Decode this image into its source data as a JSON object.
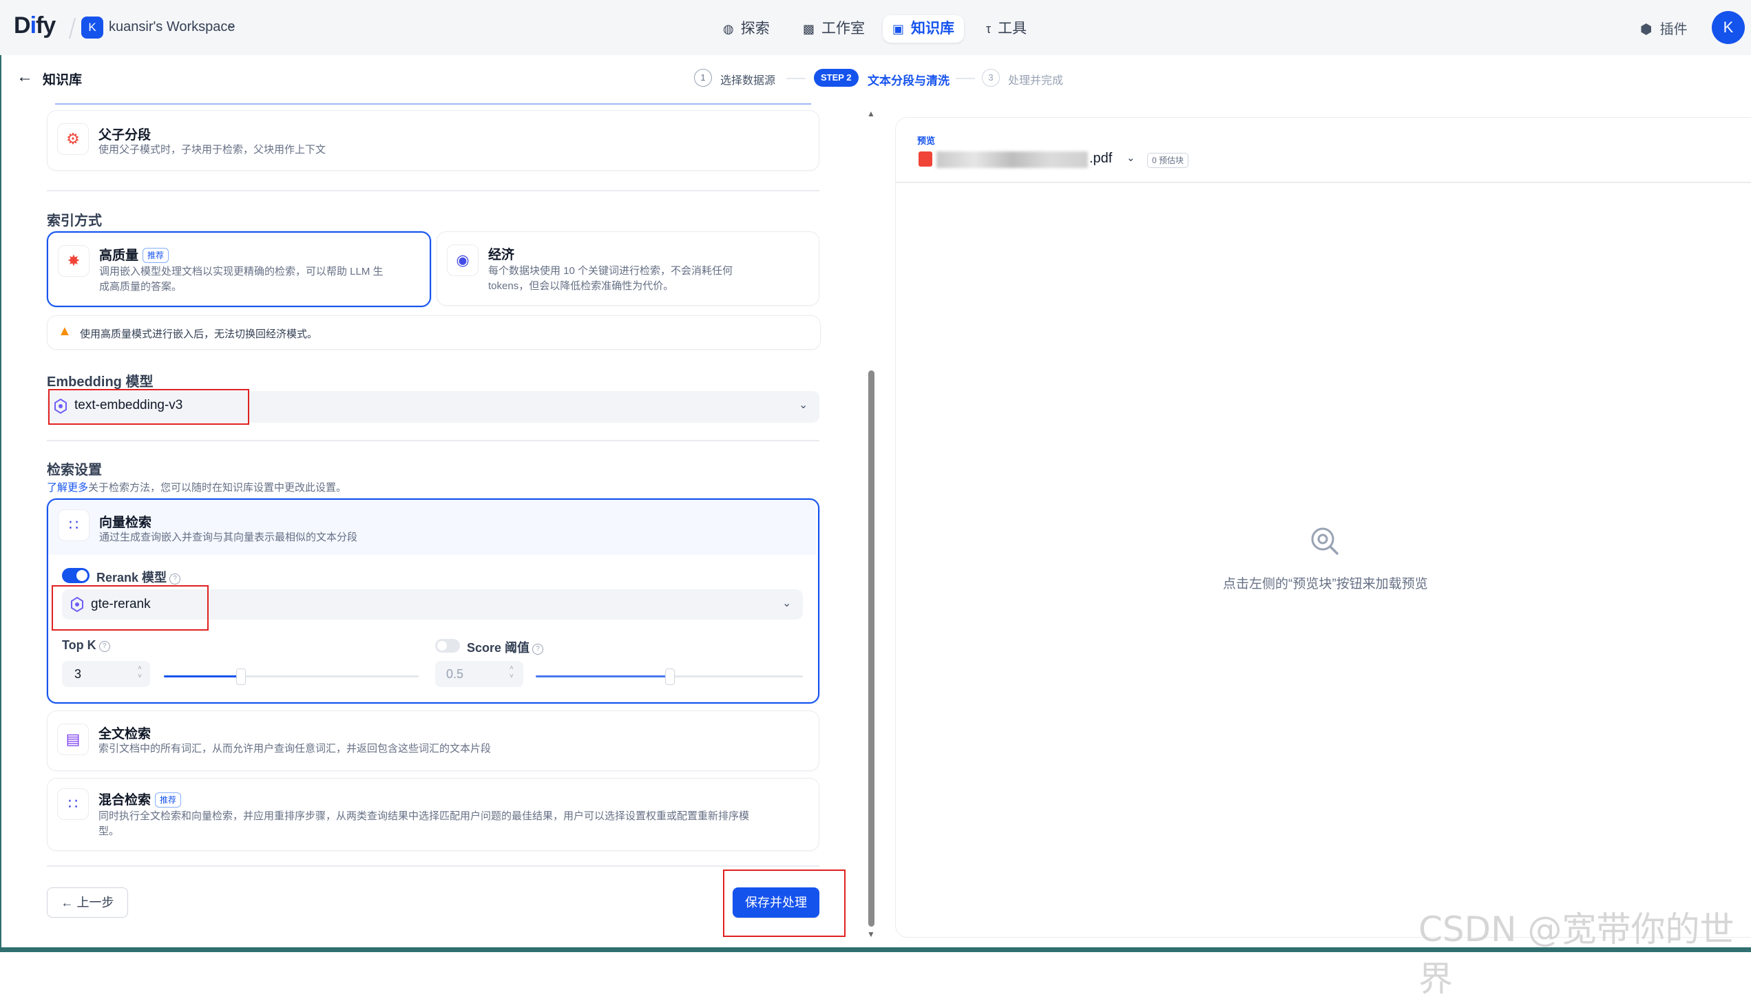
{
  "app": {
    "logo_text": "Dify",
    "workspace_initial": "K",
    "workspace_name": "kuansir's Workspace",
    "user_initial": "K"
  },
  "nav": {
    "explore": "探索",
    "studio": "工作室",
    "knowledge": "知识库",
    "tools": "工具",
    "plugins": "插件"
  },
  "header": {
    "back_title": "知识库",
    "steps": [
      {
        "num": "1",
        "label": "选择数据源"
      },
      {
        "num": "STEP 2",
        "label": "文本分段与清洗"
      },
      {
        "num": "3",
        "label": "处理并完成"
      }
    ]
  },
  "left": {
    "parent_child": {
      "title": "父子分段",
      "desc": "使用父子模式时，子块用于检索，父块用作上下文"
    },
    "index_section_title": "索引方式",
    "high_quality": {
      "title": "高质量",
      "badge": "推荐",
      "desc_line1": "调用嵌入模型处理文档以实现更精确的检索，可以帮助 LLM 生",
      "desc_line2": "成高质量的答案。"
    },
    "economy": {
      "title": "经济",
      "desc_line1": "每个数据块使用 10 个关键词进行检索，不会消耗任何",
      "desc_line2": "tokens，但会以降低检索准确性为代价。"
    },
    "warning": "使用高质量模式进行嵌入后，无法切换回经济模式。",
    "embedding_title": "Embedding 模型",
    "embedding_value": "text-embedding-v3",
    "retrieval_title": "检索设置",
    "retrieval_link": "了解更多",
    "retrieval_hint": "关于检索方法，您可以随时在知识库设置中更改此设置。",
    "vector": {
      "title": "向量检索",
      "desc": "通过生成查询嵌入并查询与其向量表示最相似的文本分段",
      "rerank_label": "Rerank 模型",
      "rerank_enabled": true,
      "rerank_value": "gte-rerank",
      "topk_label": "Top K",
      "topk_value": "3",
      "topk_fraction": 0.3,
      "score_label": "Score 阈值",
      "score_enabled": false,
      "score_value": "0.5",
      "score_fraction": 0.5
    },
    "fulltext": {
      "title": "全文检索",
      "desc": "索引文档中的所有词汇，从而允许用户查询任意词汇，并返回包含这些词汇的文本片段"
    },
    "hybrid": {
      "title": "混合检索",
      "badge": "推荐",
      "desc_line1": "同时执行全文检索和向量检索，并应用重排序步骤，从两类查询结果中选择匹配用户问题的最佳结果，用户可以选择设置权重或配置重新排序模",
      "desc_line2": "型。"
    },
    "prev_button": "上一步",
    "save_button": "保存并处理"
  },
  "preview": {
    "label": "预览",
    "file_suffix": ".pdf",
    "chunk_count": "0 预估块",
    "empty_text": "点击左侧的“预览块”按钮来加载预览"
  },
  "watermark": "CSDN @宽带你的世界",
  "colors": {
    "accent": "#1553ed",
    "highlight_box": "#e02020",
    "warning": "#f79009"
  }
}
